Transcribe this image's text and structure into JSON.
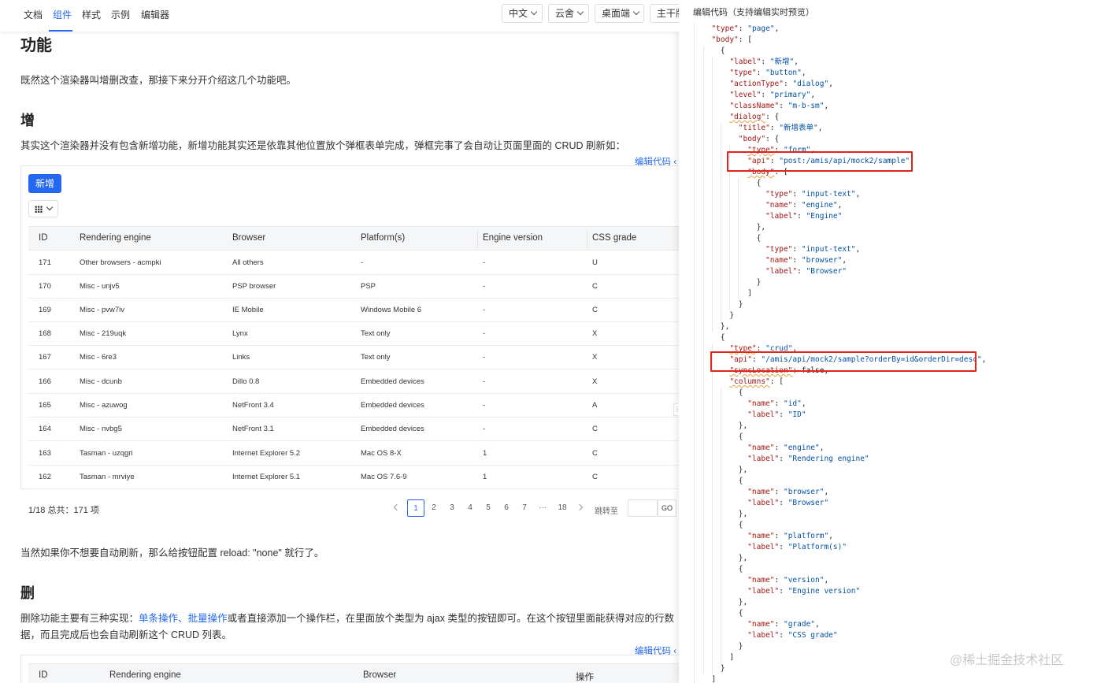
{
  "nav": {
    "links": [
      "文档",
      "组件",
      "样式",
      "示例",
      "编辑器"
    ],
    "active_link": "组件",
    "selects": [
      "中文",
      "云舍",
      "桌面端",
      "主干版"
    ]
  },
  "doc": {
    "h_features": "功能",
    "intro": "既然这个渲染器叫增删改查，那接下来分开介绍这几个功能吧。",
    "h_add": "增",
    "add_desc": "其实这个渲染器并没有包含新增功能，新增功能其实还是依靠其他位置放个弹框表单完成，弹框完事了会自动让页面里面的 CRUD 刷新如：",
    "edit_code_label": "编辑代码",
    "reload_note": "当然如果你不想要自动刷新，那么给按钮配置 reload: \"none\" 就行了。",
    "h_delete": "删",
    "delete_desc_prefix": "删除功能主要有三种实现：",
    "delete_link1": "单条操作",
    "delete_sep": "、",
    "delete_link2": "批量操作",
    "delete_desc_suffix": "或者直接添加一个操作栏，在里面放个类型为 ajax 类型的按钮即可。在这个按钮里面能获得对应的行数",
    "delete_desc_line2": "据，而且完成后也会自动刷新这个 CRUD 列表。"
  },
  "demo": {
    "add_button": "新增",
    "columns": [
      "ID",
      "Rendering engine",
      "Browser",
      "Platform(s)",
      "Engine version",
      "CSS grade"
    ],
    "rows": [
      [
        "171",
        "Other browsers - acmpki",
        "All others",
        "-",
        "-",
        "U"
      ],
      [
        "170",
        "Misc - unjv5",
        "PSP browser",
        "PSP",
        "-",
        "C"
      ],
      [
        "169",
        "Misc - pvw7iv",
        "IE Mobile",
        "Windows Mobile 6",
        "-",
        "C"
      ],
      [
        "168",
        "Misc - 219uqk",
        "Lynx",
        "Text only",
        "-",
        "X"
      ],
      [
        "167",
        "Misc - 6re3",
        "Links",
        "Text only",
        "-",
        "X"
      ],
      [
        "166",
        "Misc - dcunb",
        "Dillo 0.8",
        "Embedded devices",
        "-",
        "X"
      ],
      [
        "165",
        "Misc - azuwog",
        "NetFront 3.4",
        "Embedded devices",
        "-",
        "A"
      ],
      [
        "164",
        "Misc - nvbg5",
        "NetFront 3.1",
        "Embedded devices",
        "-",
        "C"
      ],
      [
        "163",
        "Tasman - uzqgri",
        "Internet Explorer 5.2",
        "Mac OS 8-X",
        "1",
        "C"
      ],
      [
        "162",
        "Tasman - mrviye",
        "Internet Explorer 5.1",
        "Mac OS 7.6-9",
        "1",
        "C"
      ]
    ],
    "pager_info": "1/18 总共：171 项",
    "pages": [
      "1",
      "2",
      "3",
      "4",
      "5",
      "6",
      "7",
      "···",
      "18"
    ],
    "current_page": "1",
    "jump_label": "跳转至",
    "go_label": "GO"
  },
  "demo2": {
    "columns": [
      "ID",
      "Rendering engine",
      "Browser",
      "操作"
    ]
  },
  "panel": {
    "title": "编辑代码（支持编辑实时预览）",
    "watermark": "@稀土掘金技术社区",
    "code_lines": [
      "  \"type\": \"page\",",
      "  \"body\": [",
      "    {",
      "      \"label\": \"新增\",",
      "      \"type\": \"button\",",
      "      \"actionType\": \"dialog\",",
      "      \"level\": \"primary\",",
      "      \"className\": \"m-b-sm\",",
      "      \"dialog\": {",
      "        \"title\": \"新增表单\",",
      "        \"body\": {",
      "          \"type\": \"form\",",
      "          \"api\": \"post:/amis/api/mock2/sample\",",
      "          \"body\": [",
      "            {",
      "              \"type\": \"input-text\",",
      "              \"name\": \"engine\",",
      "              \"label\": \"Engine\"",
      "            },",
      "            {",
      "              \"type\": \"input-text\",",
      "              \"name\": \"browser\",",
      "              \"label\": \"Browser\"",
      "            }",
      "          ]",
      "        }",
      "      }",
      "    },",
      "    {",
      "      \"type\": \"crud\",",
      "      \"api\": \"/amis/api/mock2/sample?orderBy=id&orderDir=desc\",",
      "      \"syncLocation\": false,",
      "      \"columns\": [",
      "        {",
      "          \"name\": \"id\",",
      "          \"label\": \"ID\"",
      "        },",
      "        {",
      "          \"name\": \"engine\",",
      "          \"label\": \"Rendering engine\"",
      "        },",
      "        {",
      "          \"name\": \"browser\",",
      "          \"label\": \"Browser\"",
      "        },",
      "        {",
      "          \"name\": \"platform\",",
      "          \"label\": \"Platform(s)\"",
      "        },",
      "        {",
      "          \"name\": \"version\",",
      "          \"label\": \"Engine version\"",
      "        },",
      "        {",
      "          \"name\": \"grade\",",
      "          \"label\": \"CSS grade\"",
      "        }",
      "      ]",
      "    }",
      "  ]"
    ],
    "highlight_color": "#e0251b"
  }
}
